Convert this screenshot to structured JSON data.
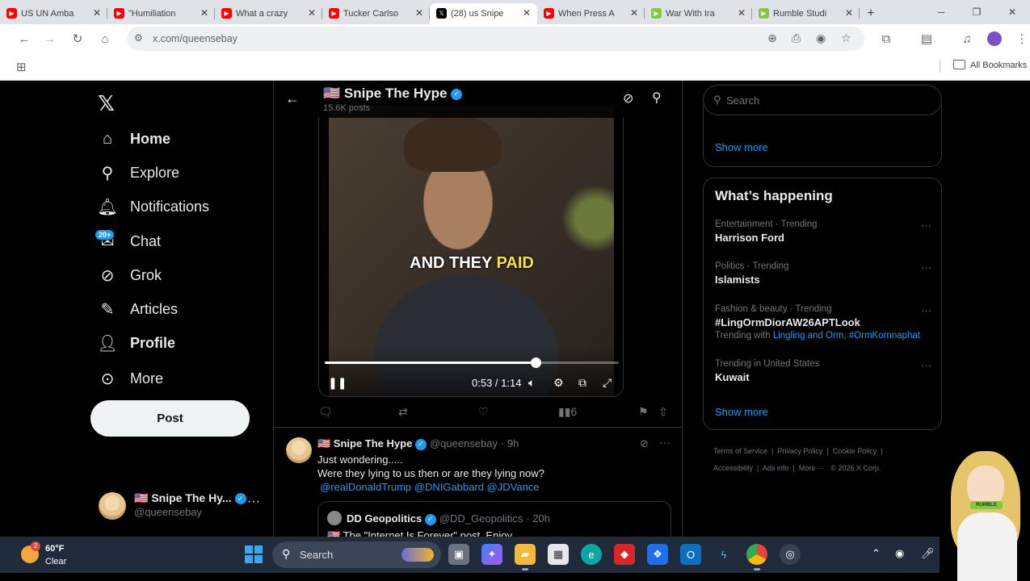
{
  "browser": {
    "tabs": [
      {
        "title": "US UN Amba",
        "favicon_color": "#ff0000",
        "active": false
      },
      {
        "title": "\"Humiliation",
        "favicon_color": "#ff0000",
        "active": false
      },
      {
        "title": "What a crazy",
        "favicon_color": "#ff0000",
        "active": false
      },
      {
        "title": "Tucker Carlso",
        "favicon_color": "#ff0000",
        "active": false
      },
      {
        "title": "(28) us Snipe",
        "favicon_color": "#000000",
        "active": true
      },
      {
        "title": "When Press A",
        "favicon_color": "#ff0000",
        "active": false
      },
      {
        "title": "War With Ira",
        "favicon_color": "#85c742",
        "active": false
      },
      {
        "title": "Rumble Studi",
        "favicon_color": "#85c742",
        "active": false
      }
    ],
    "url": "x.com/queensebay",
    "bookmarks_label": "All Bookmarks"
  },
  "nav": {
    "items": [
      {
        "label": "Home",
        "icon": "home-icon"
      },
      {
        "label": "Explore",
        "icon": "search-icon"
      },
      {
        "label": "Notifications",
        "icon": "bell-icon"
      },
      {
        "label": "Chat",
        "icon": "chat-icon"
      },
      {
        "label": "Grok",
        "icon": "grok-icon"
      },
      {
        "label": "Articles",
        "icon": "articles-icon"
      },
      {
        "label": "Profile",
        "icon": "profile-icon"
      },
      {
        "label": "More",
        "icon": "more-icon"
      }
    ],
    "chat_badge": "20+",
    "post_button": "Post",
    "account": {
      "name": "🇺🇸 Snipe The Hy...",
      "handle": "@queensebay"
    }
  },
  "header": {
    "title": "🇺🇸 Snipe The Hype",
    "posts_count": "15.6K posts"
  },
  "video": {
    "caption_plain": "AND THEY ",
    "caption_highlight": "PAID",
    "time": "0:53 / 1:14",
    "progress": 0.7162
  },
  "actions": {
    "views": "6"
  },
  "tweet2": {
    "name": "🇺🇸 Snipe The Hype",
    "handle": "@queensebay",
    "time": "· 9h",
    "line1": "Just wondering.....",
    "line2": "Were they lying to us then or are they lying now?",
    "mentions": "@realDonaldTrump @DNIGabbard @JDVance",
    "quote": {
      "name": "DD Geopolitics",
      "handle": "@DD_Geopolitics",
      "time": "· 20h",
      "text": "🇺🇸 The \"Internet Is Forever\" post. Enjoy."
    }
  },
  "sidebar": {
    "search_placeholder": "Search",
    "top_show_more": "Show more",
    "happening_title": "What’s happening",
    "trends": [
      {
        "category": "Entertainment · Trending",
        "name": "Harrison Ford"
      },
      {
        "category": "Politics · Trending",
        "name": "Islamists"
      },
      {
        "category": "Fashion & beauty · Trending",
        "name": "#LingOrmDiorAW26APTLook",
        "with_prefix": "Trending with ",
        "with_tags": "Lingling and Orm, #OrmKornnaphat"
      },
      {
        "category": "Trending in United States",
        "name": "Kuwait"
      }
    ],
    "show_more": "Show more",
    "footer": {
      "terms": "Terms of Service",
      "privacy": "Privacy Policy",
      "cookie": "Cookie Policy",
      "accessibility": "Accessibility",
      "ads": "Ads info",
      "more": "More ···",
      "copyright": "© 2026 X Corp."
    }
  },
  "taskbar": {
    "weather_badge": "2",
    "temp": "60°F",
    "condition": "Clear",
    "search_label": "Search"
  },
  "mascot": {
    "logo_text": "RUMBLE"
  }
}
